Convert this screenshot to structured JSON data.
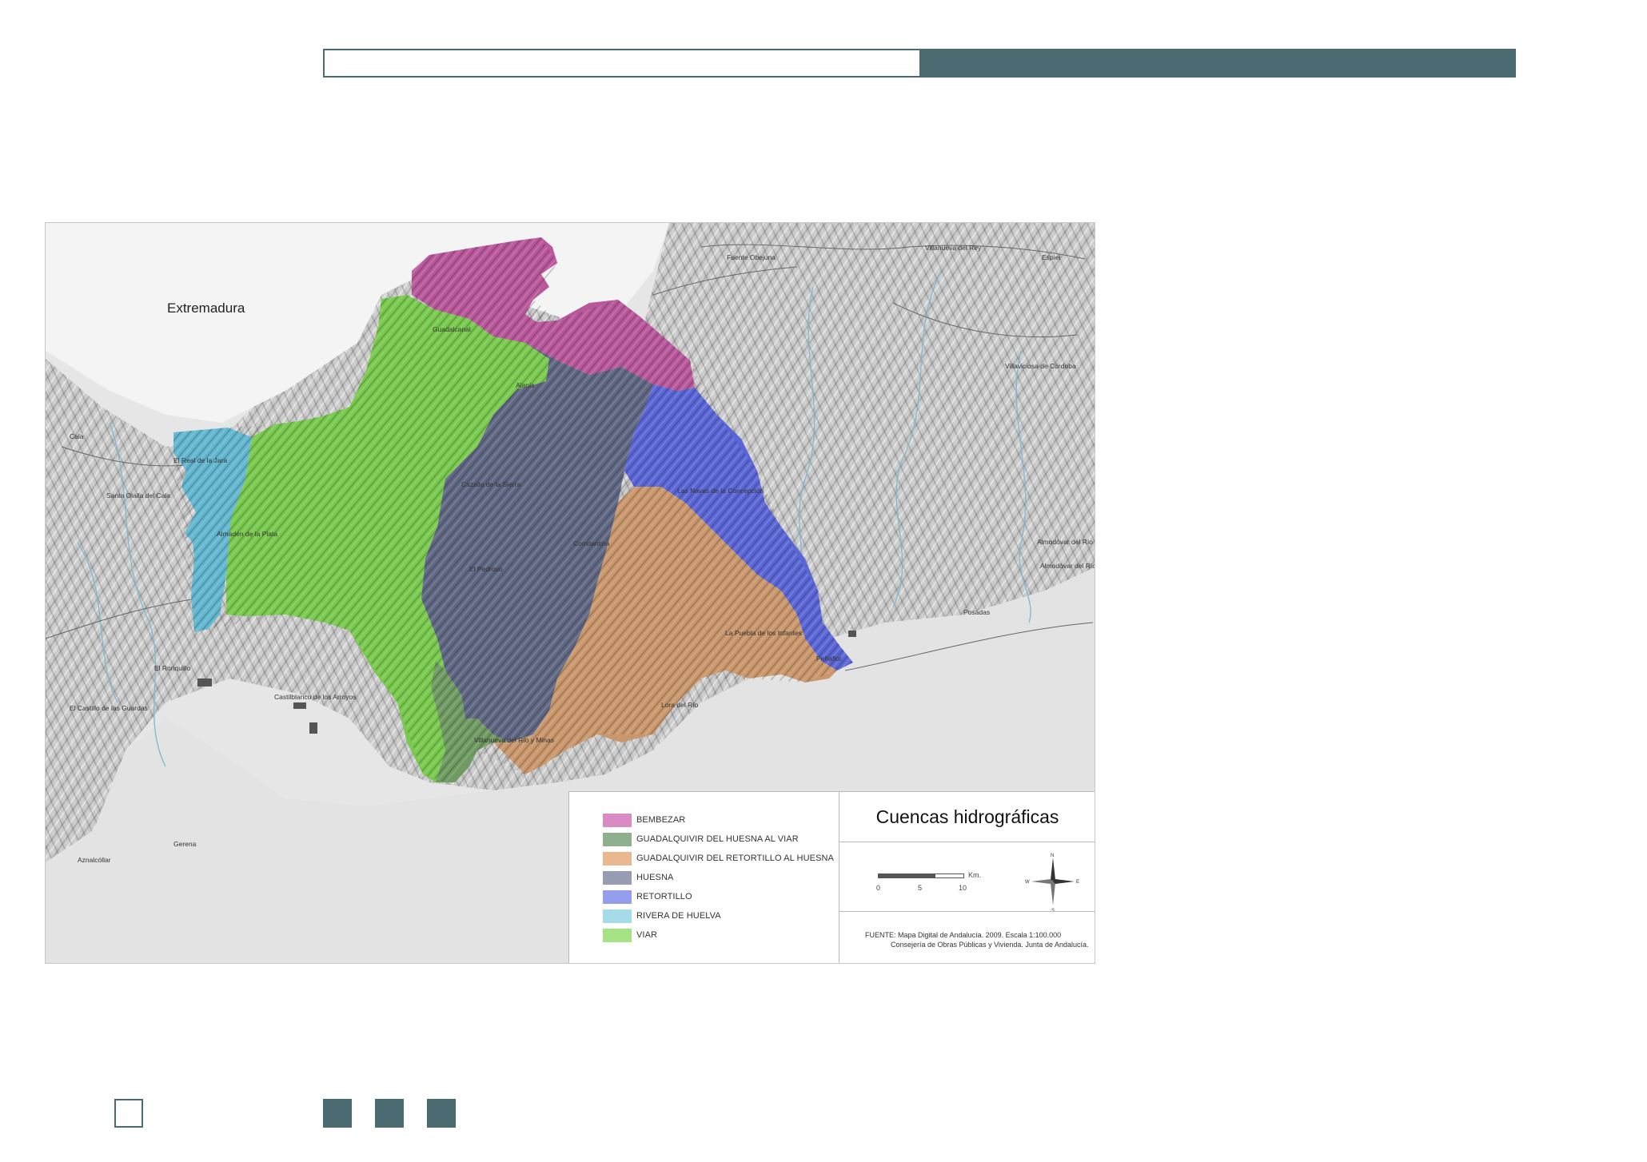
{
  "map": {
    "region_label": "Extremadura",
    "places": [
      {
        "name": "Fuente Obejuna"
      },
      {
        "name": "Villanueva del Rey"
      },
      {
        "name": "Espiel"
      },
      {
        "name": "Guadalcanal"
      },
      {
        "name": "Alanís"
      },
      {
        "name": "Villaviciosa de Córdoba"
      },
      {
        "name": "Cala"
      },
      {
        "name": "El Real de la Jara"
      },
      {
        "name": "Santa Olalla del Cala"
      },
      {
        "name": "Cazalla de la Sierra"
      },
      {
        "name": "Las Navas de la Concepción"
      },
      {
        "name": "Almadén de la Plata"
      },
      {
        "name": "Constantina"
      },
      {
        "name": "El Pedroso"
      },
      {
        "name": "Almodóvar del Río"
      },
      {
        "name": "Almodóvar del Río"
      },
      {
        "name": "Posadas"
      },
      {
        "name": "La Puebla de los Infantes"
      },
      {
        "name": "Peñaflor"
      },
      {
        "name": "El Ronquillo"
      },
      {
        "name": "Castilblanco de los Arroyos"
      },
      {
        "name": "El Castillo de las Guardas"
      },
      {
        "name": "Lora del Río"
      },
      {
        "name": "Villanueva del Río y Minas"
      },
      {
        "name": "Gerena"
      },
      {
        "name": "Aznalcóllar"
      }
    ]
  },
  "legend": {
    "items": [
      {
        "label": "BEMBEZAR",
        "color": "#d98cc4"
      },
      {
        "label": "GUADALQUIVIR DEL HUESNA AL VIAR",
        "color": "#8fb08c"
      },
      {
        "label": "GUADALQUIVIR DEL RETORTILLO AL HUESNA",
        "color": "#e9b891"
      },
      {
        "label": "HUESNA",
        "color": "#979cb2"
      },
      {
        "label": "RETORTILLO",
        "color": "#959ded"
      },
      {
        "label": "RIVERA DE HUELVA",
        "color": "#a6dbe8"
      },
      {
        "label": "VIAR",
        "color": "#a5e385"
      }
    ],
    "title": "Cuencas hidrográficas",
    "scale": {
      "ticks": [
        "0",
        "5",
        "10"
      ],
      "unit": "Km."
    },
    "compass": {
      "n": "N",
      "s": "S",
      "e": "E",
      "w": "W"
    },
    "source_line1": "FUENTE: Mapa Digital de Andalucía. 2009. Escala 1:100.000",
    "source_line2": "Consejería de Obras Públicas y Vivienda. Junta de Andalucía."
  },
  "colors": {
    "accent": "#4a6b72",
    "bembezar": "#b9579b",
    "guadalquivir_huesna_viar": "#6f9a62",
    "guadalquivir_retortillo_huesna": "#c9976b",
    "huesna": "#5f6782",
    "retortillo": "#5b66d6",
    "rivera_de_huelva": "#62b6d0",
    "viar": "#79c94f"
  }
}
